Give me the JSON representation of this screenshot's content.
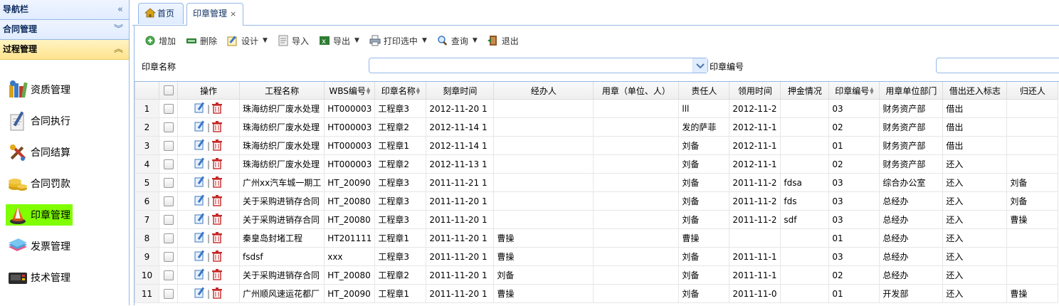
{
  "sidebar": {
    "nav_title": "导航栏",
    "sections": [
      {
        "label": "合同管理"
      },
      {
        "label": "过程管理"
      }
    ],
    "items": [
      {
        "label": "资质管理",
        "icon": "books-icon"
      },
      {
        "label": "合同执行",
        "icon": "pen-paper-icon"
      },
      {
        "label": "合同结算",
        "icon": "tools-icon"
      },
      {
        "label": "合同罚款",
        "icon": "coins-icon"
      },
      {
        "label": "印章管理",
        "icon": "seal-icon"
      },
      {
        "label": "发票管理",
        "icon": "papers-icon"
      },
      {
        "label": "技术管理",
        "icon": "device-icon"
      }
    ]
  },
  "tabs": {
    "home": "首页",
    "active": "印章管理",
    "close": "×"
  },
  "toolbar": {
    "add": "增加",
    "delete": "删除",
    "design": "设计",
    "import": "导入",
    "export": "导出",
    "print": "打印选中",
    "query": "查询",
    "exit": "退出"
  },
  "search": {
    "seal_name_label": "印章名称",
    "seal_no_label": "印章编号",
    "seal_name_value": "",
    "seal_no_value": ""
  },
  "grid": {
    "columns": [
      "操作",
      "工程名称",
      "WBS编号",
      "印章名称",
      "刻章时间",
      "经办人",
      "用章（单位、人）",
      "责任人",
      "领用时间",
      "押金情况",
      "印章编号",
      "用章单位部门",
      "借出还入标志",
      "归还人"
    ],
    "rows": [
      [
        "1",
        "珠海纺织厂废水处理",
        "HT000003",
        "工程章3",
        "2012-11-20 1",
        "",
        "",
        "lll",
        "2012-11-2",
        "",
        "03",
        "财务资产部",
        "借出",
        ""
      ],
      [
        "2",
        "珠海纺织厂废水处理",
        "HT000003",
        "工程章2",
        "2012-11-14 1",
        "",
        "",
        "发的萨菲",
        "2012-11-1",
        "",
        "02",
        "财务资产部",
        "借出",
        ""
      ],
      [
        "3",
        "珠海纺织厂废水处理",
        "HT000003",
        "工程章1",
        "2012-11-14 1",
        "",
        "",
        "刘备",
        "2012-11-1",
        "",
        "01",
        "财务资产部",
        "借出",
        ""
      ],
      [
        "4",
        "珠海纺织厂废水处理",
        "HT000003",
        "工程章2",
        "2012-11-13 1",
        "",
        "",
        "刘备",
        "2012-11-1",
        "",
        "02",
        "财务资产部",
        "还入",
        ""
      ],
      [
        "5",
        "广州xx汽车城一期工",
        "HT_20090",
        "工程章3",
        "2011-11-21 1",
        "",
        "",
        "刘备",
        "2011-11-2",
        "fdsa",
        "03",
        "综合办公室",
        "还入",
        "刘备"
      ],
      [
        "6",
        "关于采购进销存合同",
        "HT_20080",
        "工程章3",
        "2011-11-20 1",
        "",
        "",
        "刘备",
        "2011-11-2",
        "fds",
        "03",
        "总经办",
        "还入",
        "刘备"
      ],
      [
        "7",
        "关于采购进销存合同",
        "HT_20080",
        "工程章3",
        "2011-11-20 1",
        "",
        "",
        "刘备",
        "2011-11-2",
        "sdf",
        "03",
        "总经办",
        "还入",
        "曹操"
      ],
      [
        "8",
        "秦皇岛封堵工程",
        "HT201111",
        "工程章1",
        "2011-11-20 1",
        "曹操",
        "",
        "曹操",
        "",
        "",
        "01",
        "总经办",
        "还入",
        ""
      ],
      [
        "9",
        "fsdsf",
        "xxx",
        "工程章3",
        "2011-11-20 1",
        "曹操",
        "",
        "刘备",
        "2011-11-1",
        "",
        "03",
        "总经办",
        "还入",
        ""
      ],
      [
        "10",
        "关于采购进销存合同",
        "HT_20080",
        "工程章2",
        "2011-11-20 1",
        "刘备",
        "",
        "刘备",
        "2011-11-1",
        "",
        "02",
        "总经办",
        "还入",
        ""
      ],
      [
        "11",
        "广州顺风速运花都厂",
        "HT_20090",
        "工程章1",
        "2011-11-20 1",
        "曹操",
        "",
        "刘备",
        "2011-11-0",
        "",
        "01",
        "开发部",
        "还入",
        "曹操"
      ]
    ]
  }
}
